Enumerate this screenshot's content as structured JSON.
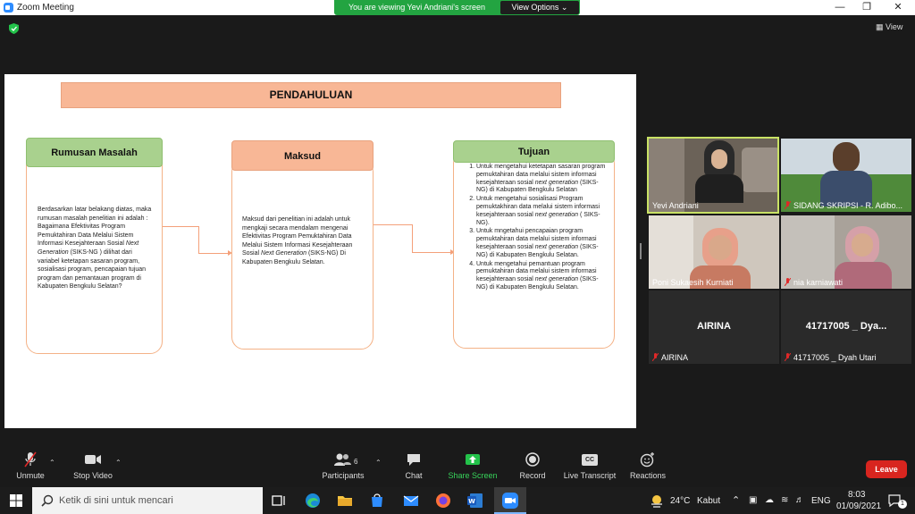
{
  "window": {
    "title": "Zoom Meeting"
  },
  "banner": {
    "text": "You are viewing Yevi Andriani's screen",
    "options_label": "View Options"
  },
  "view_label": "View",
  "slide": {
    "heading": "PENDAHULUAN",
    "rumusan": {
      "title": "Rumusan Masalah",
      "text_before": "Berdasarkan latar belakang diatas, maka rumusan masalah penelitian ini adalah : Bagaimana Efektivitas Program Pemuktahiran Data Melalui Sistem Informasi Kesejahteraan Sosial ",
      "text_italic": "Next Generation",
      "text_after": " (SIKS-NG ) dilihat dari variabel ketetapan sasaran program, sosialisasi program, pencapaian tujuan program dan pemantauan program di Kabupaten Bengkulu Selatan?"
    },
    "maksud": {
      "title": "Maksud",
      "text_before": "Maksud dari penelitian ini adalah untuk mengkaji secara mendalam mengenai Efektivitas Program Pemuktahiran Data Melalui Sistem Informasi Kesejahteraan Sosial ",
      "text_italic": "Next Generation",
      "text_after": " (SIKS-NG) Di Kabupaten Bengkulu Selatan."
    },
    "tujuan": {
      "title": "Tujuan",
      "items": [
        {
          "before": "Untuk mengetahui  ketetapan sasaran program pemuktahiran data melalui sistem informasi kesejahteraan sosial ",
          "italic": "next generation",
          "after": " (SIKS-NG) di Kabupaten Bengkulu Selatan"
        },
        {
          "before": "Untuk mengetahui sosialisasi Program pemuktakhiran data melalui sistem informasi kesejahteraan sosial ",
          "italic": "next generation",
          "after": " ( SIKS-NG)."
        },
        {
          "before": "Untuk mngetahui pencapaian program pemuktahiran data melalui sistem informasi kesejahteraan sosial ",
          "italic": "next generation",
          "after": " (SIKS-NG) di Kabupaten Bengkulu Selatan."
        },
        {
          "before": "Untuk mengetahui pemantuan program pemuktahiran data melalui sistem informasi kesejahteraan sosial ",
          "italic": "next generation",
          "after": " (SIKS-NG) di Kabupaten Bengkulu Selatan."
        }
      ]
    }
  },
  "participants": [
    {
      "name": "Yevi Andriani",
      "muted": false,
      "active": true
    },
    {
      "name": "SIDANG SKRIPSI - R. Adibo...",
      "muted": true,
      "active": false
    },
    {
      "name": "Poni Sukaesih Kurniati",
      "muted": false,
      "active": false
    },
    {
      "name": "nia karniawati",
      "muted": true,
      "active": false
    },
    {
      "name": "AIRINA",
      "big": "AIRINA",
      "muted": true,
      "active": false
    },
    {
      "name": "41717005 _ Dyah Utari",
      "big": "41717005 _ Dya...",
      "muted": true,
      "active": false
    }
  ],
  "toolbar": {
    "unmute": "Unmute",
    "stop_video": "Stop Video",
    "participants": "Participants",
    "participants_count": "6",
    "chat": "Chat",
    "share_screen": "Share Screen",
    "record": "Record",
    "live_transcript": "Live Transcript",
    "reactions": "Reactions",
    "leave": "Leave",
    "cc_badge": "CC"
  },
  "taskbar": {
    "search_placeholder": "Ketik di sini untuk mencari",
    "weather_temp": "24°C",
    "weather_text": "Kabut",
    "lang": "ENG",
    "time": "8:03",
    "date": "01/09/2021",
    "notif_count": "1"
  },
  "colors": {
    "accent_green": "#23a441",
    "leave_red": "#d8251f",
    "heading_orange": "#f8b796",
    "green_header": "#a9d18e",
    "active_border": "#c9e265"
  }
}
